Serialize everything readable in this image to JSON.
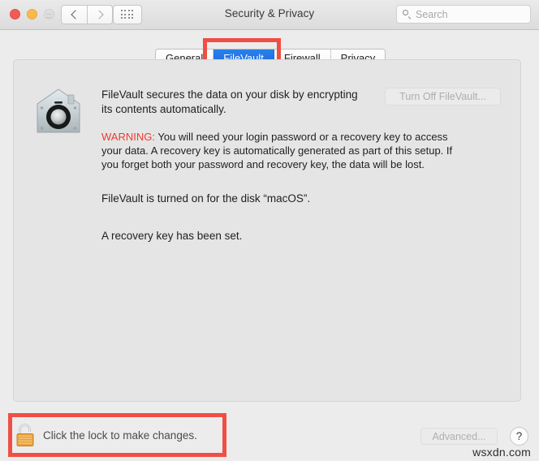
{
  "window": {
    "title": "Security & Privacy",
    "traffic_lights": [
      {
        "name": "close",
        "color": "#f25a55"
      },
      {
        "name": "minimize",
        "color": "#f7ba4b"
      },
      {
        "name": "zoom",
        "color": "#dedede"
      }
    ],
    "nav": {
      "back_icon": "chevron-left-icon",
      "forward_icon": "chevron-right-icon",
      "grid_icon": "show-all-grid-icon"
    },
    "search": {
      "placeholder": "Search",
      "value": "",
      "icon": "search-icon"
    }
  },
  "tabs": [
    {
      "label": "General",
      "selected": false
    },
    {
      "label": "FileVault",
      "selected": true
    },
    {
      "label": "Firewall",
      "selected": false
    },
    {
      "label": "Privacy",
      "selected": false
    }
  ],
  "panel": {
    "icon": "filevault-safe-icon",
    "intro": "FileVault secures the data on your disk by encrypting its contents automatically.",
    "warning_label": "WARNING:",
    "warning_text": "You will need your login password or a recovery key to access your data. A recovery key is automatically generated as part of this setup. If you forget both your password and recovery key, the data will be lost.",
    "status_disk": "FileVault is turned on for the disk “macOS”.",
    "status_key": "A recovery key has been set.",
    "turn_off_button": "Turn Off FileVault...",
    "turn_off_disabled": true
  },
  "footer": {
    "lock_icon": "unlocked-padlock-icon",
    "lock_label": "Click the lock to make changes.",
    "advanced_button": "Advanced...",
    "advanced_disabled": true,
    "help_button": "?",
    "watermark": "wsxdn.com"
  },
  "annotations": {
    "color": "#ef4f44",
    "regions": [
      {
        "name": "filevault-tab-highlight"
      },
      {
        "name": "lock-bar-highlight"
      }
    ]
  }
}
